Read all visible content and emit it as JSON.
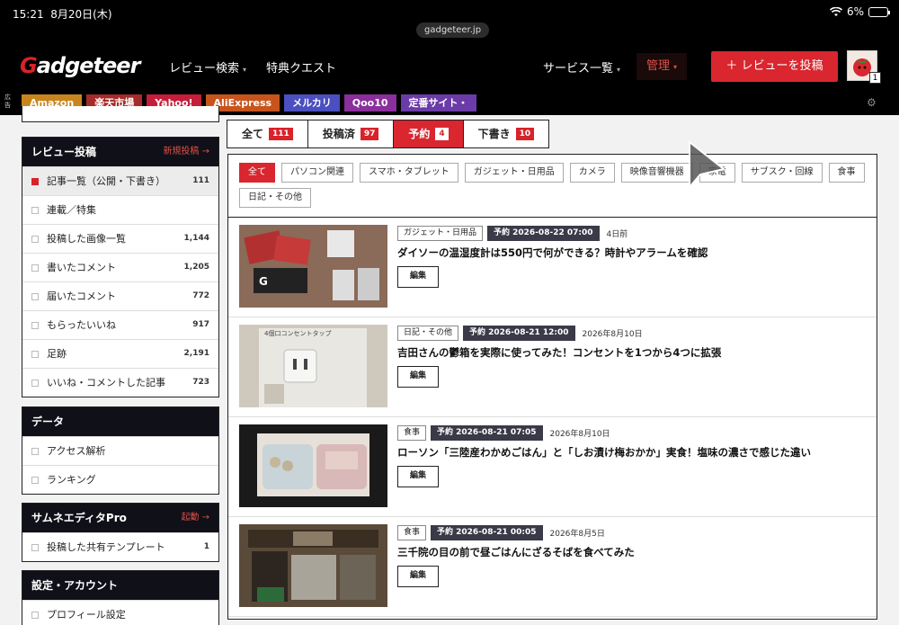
{
  "status": {
    "time": "15:21",
    "date": "8月20日(木)",
    "battery": "6%",
    "battery_level": 0.06,
    "url": "gadgeteer.jp"
  },
  "header": {
    "logo_g": "G",
    "logo_rest": "adgeteer",
    "nav": [
      "レビュー検索",
      "特典クエスト"
    ],
    "services": "サービス一覧",
    "manage": "管理",
    "post_button": "＋ レビューを投稿",
    "avatar_badge": "1"
  },
  "adbar": {
    "label": "広告",
    "items": [
      {
        "label": "Amazon",
        "color": "#c8851d"
      },
      {
        "label": "楽天市場",
        "color": "#a52a2a"
      },
      {
        "label": "Yahoo!",
        "color": "#c41e3a"
      },
      {
        "label": "AliExpress",
        "color": "#c8541d"
      },
      {
        "label": "メルカリ",
        "color": "#4b4fbf"
      },
      {
        "label": "Qoo10",
        "color": "#8a2f9c"
      },
      {
        "label": "定番サイト・",
        "color": "#6b3ca8"
      }
    ]
  },
  "sidebar": {
    "review": {
      "title": "レビュー投稿",
      "link": "新規投稿 →",
      "items": [
        {
          "label": "記事一覧（公開・下書き）",
          "count": "111"
        },
        {
          "label": "連載／特集",
          "count": ""
        },
        {
          "label": "投稿した画像一覧",
          "count": "1,144"
        },
        {
          "label": "書いたコメント",
          "count": "1,205"
        },
        {
          "label": "届いたコメント",
          "count": "772"
        },
        {
          "label": "もらったいいね",
          "count": "917"
        },
        {
          "label": "足跡",
          "count": "2,191"
        },
        {
          "label": "いいね・コメントした記事",
          "count": "723"
        }
      ]
    },
    "data": {
      "title": "データ",
      "items": [
        {
          "label": "アクセス解析"
        },
        {
          "label": "ランキング"
        }
      ]
    },
    "thumb": {
      "title": "サムネエディタPro",
      "link": "起動 →",
      "items": [
        {
          "label": "投稿した共有テンプレート",
          "count": "1"
        }
      ]
    },
    "settings": {
      "title": "設定・アカウント",
      "items": [
        {
          "label": "プロフィール設定"
        }
      ]
    }
  },
  "tabs": [
    {
      "label": "全て",
      "count": "111"
    },
    {
      "label": "投稿済",
      "count": "97"
    },
    {
      "label": "予約",
      "count": "4"
    },
    {
      "label": "下書き",
      "count": "10"
    }
  ],
  "categories": [
    "全て",
    "パソコン関連",
    "スマホ・タブレット",
    "ガジェット・日用品",
    "カメラ",
    "映像音響機器",
    "家電",
    "サブスク・回線",
    "食事",
    "日記・その他"
  ],
  "posts": [
    {
      "category": "ガジェット・日用品",
      "schedule": "予約 2026-08-22 07:00",
      "date": "4日前",
      "title": "ダイソーの温湿度計は550円で何ができる？時計やアラームを確認",
      "edit": "編集"
    },
    {
      "category": "日記・その他",
      "schedule": "予約 2026-08-21 12:00",
      "date": "2026年8月10日",
      "title": "吉田さんの鬱箱を実際に使ってみた！コンセントを1つから4つに拡張",
      "edit": "編集"
    },
    {
      "category": "食事",
      "schedule": "予約 2026-08-21 07:05",
      "date": "2026年8月10日",
      "title": "ローソン「三陸産わかめごはん」と「しお漬け梅おかか」実食！塩味の濃さで感じた違い",
      "edit": "編集"
    },
    {
      "category": "食事",
      "schedule": "予約 2026-08-21 00:05",
      "date": "2026年8月5日",
      "title": "三千院の目の前で昼ごはんにざるそばを食べてみた",
      "edit": "編集"
    }
  ],
  "thumb_texts": {
    "t2": "4個口コンセントタップ"
  }
}
